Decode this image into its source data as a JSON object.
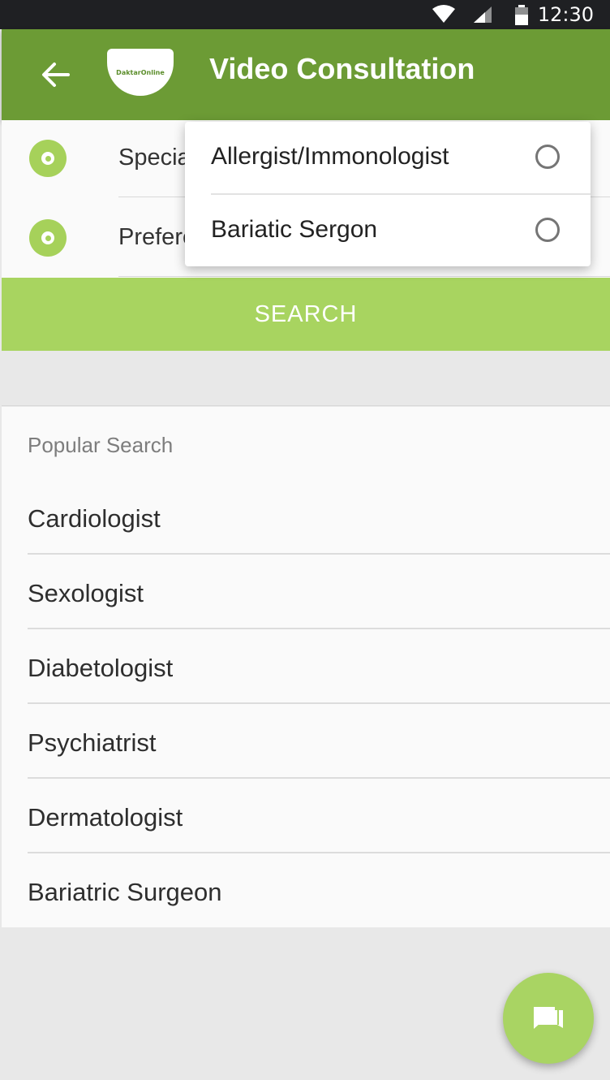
{
  "status_bar": {
    "time": "12:30",
    "icons": [
      "wifi-icon",
      "cell-signal-icon",
      "battery-icon"
    ]
  },
  "app_bar": {
    "title": "Video Consultation",
    "logo_text": "DaktarOnline",
    "back_icon": "arrow-left-icon"
  },
  "form": {
    "rows": [
      {
        "label": "Specialization",
        "selected": true
      },
      {
        "label": "Preference",
        "selected": true
      }
    ]
  },
  "search_button": {
    "label": "SEARCH"
  },
  "dropdown": {
    "options": [
      {
        "label": "Allergist/Immonologist",
        "checked": false
      },
      {
        "label": "Bariatic Sergon",
        "checked": false
      }
    ]
  },
  "popular": {
    "heading": "Popular Search",
    "items": [
      "Cardiologist",
      "Sexologist",
      "Diabetologist",
      "Psychiatrist",
      "Dermatologist",
      "Bariatric Surgeon"
    ]
  },
  "fab": {
    "icon": "chat-bubbles-icon"
  },
  "colors": {
    "primary": "#6c9b35",
    "accent": "#a8d460",
    "status_bar": "#1f2023"
  }
}
